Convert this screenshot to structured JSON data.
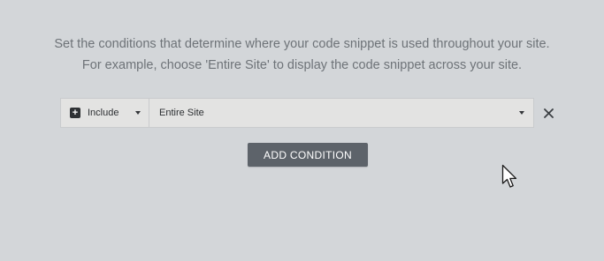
{
  "description": {
    "line1": "Set the conditions that determine where your code snippet is used throughout your site.",
    "line2": "For example, choose 'Entire Site' to display the code snippet across your site."
  },
  "condition": {
    "rule_label": "Include",
    "target_label": "Entire Site",
    "rule_icon": "plus-square-icon",
    "dropdown_icon": "caret-down-icon",
    "remove_icon": "close-icon"
  },
  "actions": {
    "add_condition_label": "ADD CONDITION"
  },
  "colors": {
    "background": "#d3d6d9",
    "button": "#5d636a",
    "field": "#e3e3e2"
  }
}
